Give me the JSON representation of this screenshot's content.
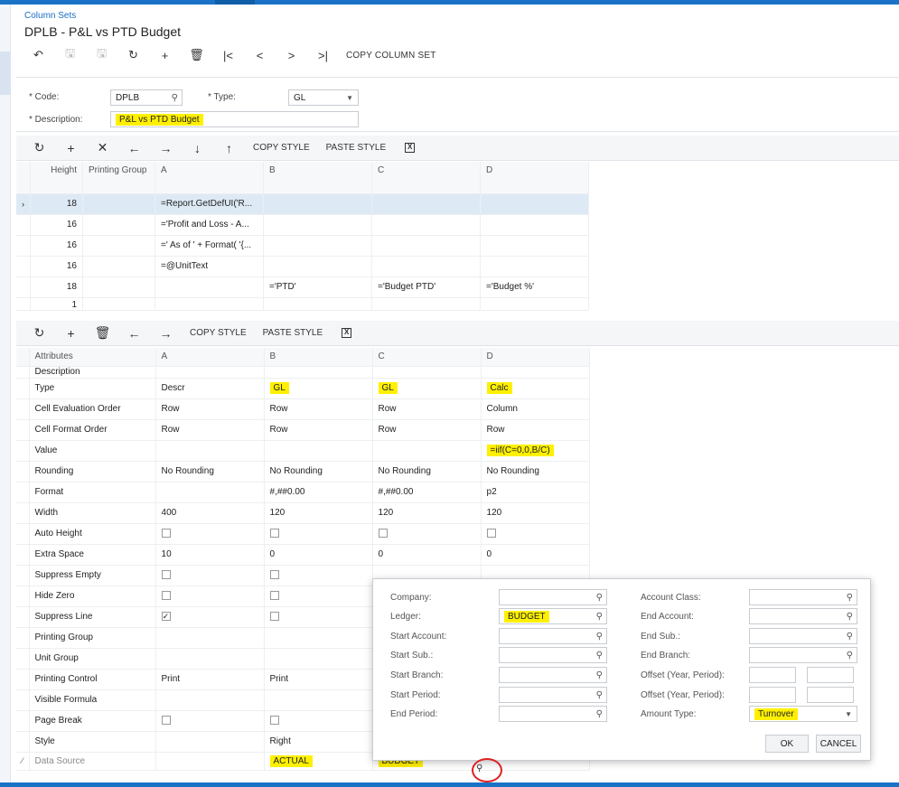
{
  "header": {
    "breadcrumb": "Column Sets",
    "title": "DPLB - P&L vs PTD Budget"
  },
  "toolbar": {
    "copy_label": "COPY COLUMN SET"
  },
  "form": {
    "code_label": "Code:",
    "code_value": "DPLB",
    "type_label": "Type:",
    "type_value": "GL",
    "desc_label": "Description:",
    "desc_value": "P&L vs PTD Budget"
  },
  "grid1_toolbar": {
    "copy_style": "COPY STYLE",
    "paste_style": "PASTE STYLE"
  },
  "grid1": {
    "headers": {
      "height": "Height",
      "printing_group": "Printing Group",
      "a": "A",
      "b": "B",
      "c": "C",
      "d": "D"
    },
    "rows": [
      {
        "height": "18",
        "a": "=Report.GetDefUI('R...",
        "b": "",
        "c": "",
        "d": ""
      },
      {
        "height": "16",
        "a": "='Profit and Loss - A...",
        "b": "",
        "c": "",
        "d": ""
      },
      {
        "height": "16",
        "a": "=' As of ' + Format( '{...",
        "b": "",
        "c": "",
        "d": ""
      },
      {
        "height": "16",
        "a": "=@UnitText",
        "b": "",
        "c": "",
        "d": ""
      },
      {
        "height": "18",
        "a": "",
        "b": "='PTD'",
        "c": "='Budget PTD'",
        "d": "='Budget %'"
      },
      {
        "height": "1",
        "a": "",
        "b": "",
        "c": "",
        "d": ""
      }
    ]
  },
  "grid2_toolbar": {
    "copy_style": "COPY STYLE",
    "paste_style": "PASTE STYLE"
  },
  "grid2": {
    "headers": {
      "attributes": "Attributes",
      "a": "A",
      "b": "B",
      "c": "C",
      "d": "D"
    },
    "rows": {
      "description": {
        "label": "Description"
      },
      "type": {
        "label": "Type",
        "a": "Descr",
        "b": "GL",
        "c": "GL",
        "d": "Calc"
      },
      "eval_order": {
        "label": "Cell Evaluation Order",
        "a": "Row",
        "b": "Row",
        "c": "Row",
        "d": "Column"
      },
      "format_order": {
        "label": "Cell Format Order",
        "a": "Row",
        "b": "Row",
        "c": "Row",
        "d": "Row"
      },
      "value": {
        "label": "Value",
        "d": "=iif(C=0,0,B/C)"
      },
      "rounding": {
        "label": "Rounding",
        "a": "No Rounding",
        "b": "No Rounding",
        "c": "No Rounding",
        "d": "No Rounding"
      },
      "format": {
        "label": "Format",
        "b": "#,##0.00",
        "c": "#,##0.00",
        "d": "p2"
      },
      "width": {
        "label": "Width",
        "a": "400",
        "b": "120",
        "c": "120",
        "d": "120"
      },
      "auto_height": {
        "label": "Auto Height"
      },
      "extra_space": {
        "label": "Extra Space",
        "a": "10",
        "b": "0",
        "c": "0",
        "d": "0"
      },
      "suppress_empty": {
        "label": "Suppress Empty"
      },
      "hide_zero": {
        "label": "Hide Zero"
      },
      "suppress_line": {
        "label": "Suppress Line",
        "a_checked": true
      },
      "printing_group": {
        "label": "Printing Group"
      },
      "unit_group": {
        "label": "Unit Group"
      },
      "printing_control": {
        "label": "Printing Control",
        "a": "Print",
        "b": "Print"
      },
      "visible_formula": {
        "label": "Visible Formula"
      },
      "page_break": {
        "label": "Page Break"
      },
      "style": {
        "label": "Style",
        "b": "Right"
      },
      "data_source": {
        "label": "Data Source",
        "b": "ACTUAL",
        "c": "BUDGET"
      }
    }
  },
  "popup": {
    "company_label": "Company:",
    "ledger_label": "Ledger:",
    "ledger_value": "BUDGET",
    "start_account_label": "Start Account:",
    "start_sub_label": "Start Sub.:",
    "start_branch_label": "Start Branch:",
    "start_period_label": "Start Period:",
    "end_period_label": "End Period:",
    "account_class_label": "Account Class:",
    "end_account_label": "End Account:",
    "end_sub_label": "End Sub.:",
    "end_branch_label": "End Branch:",
    "offset1_label": "Offset (Year, Period):",
    "offset2_label": "Offset (Year, Period):",
    "amount_type_label": "Amount Type:",
    "amount_type_value": "Turnover",
    "ok_label": "OK",
    "cancel_label": "CANCEL"
  },
  "icons": {
    "back": "back-arrow-icon",
    "save": "save-icon",
    "undo": "undo-icon",
    "add": "plus-icon",
    "delete": "trash-icon",
    "first": "first-icon",
    "prev": "prev-icon",
    "next": "next-icon",
    "last": "last-icon",
    "search": "search-icon",
    "refresh": "refresh-icon",
    "excel": "excel-icon"
  },
  "colors": {
    "accent": "#1a73c7",
    "highlight": "#fff000",
    "annotation": "#e02020",
    "selected_row": "#ddeaf6"
  }
}
